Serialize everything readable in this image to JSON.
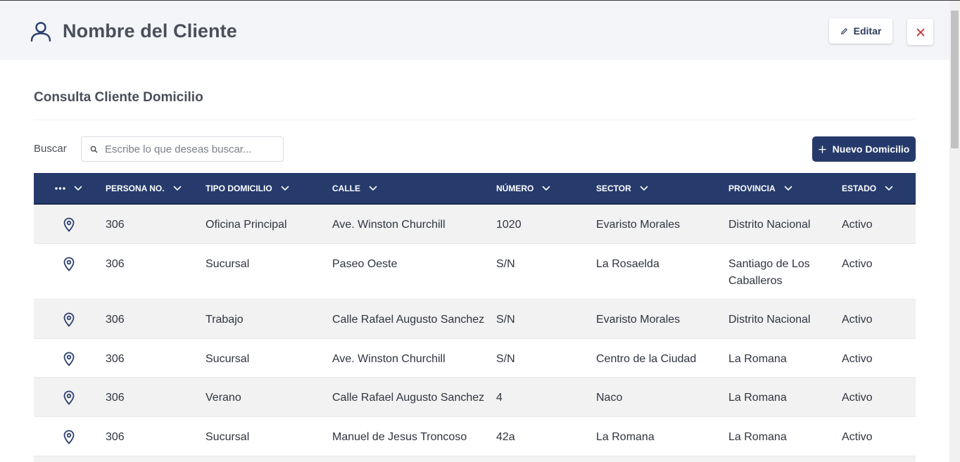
{
  "header": {
    "title": "Nombre del Cliente",
    "edit_label": "Editar"
  },
  "section": {
    "title": "Consulta Cliente Domicilio"
  },
  "search": {
    "label": "Buscar",
    "placeholder": "Escribe lo que deseas buscar...",
    "value": ""
  },
  "toolbar": {
    "new_label": "Nuevo Domicilio"
  },
  "table": {
    "columns": [
      "PERSONA NO.",
      "TIPO DOMICILIO",
      "CALLE",
      "NÚMERO",
      "SECTOR",
      "PROVINCIA",
      "ESTADO"
    ],
    "rows": [
      {
        "persona": "306",
        "tipo": "Oficina Principal",
        "calle": "Ave. Winston Churchill",
        "numero": "1020",
        "sector": "Evaristo Morales",
        "provincia": [
          "Distrito Nacional"
        ],
        "estado": "Activo"
      },
      {
        "persona": "306",
        "tipo": "Sucursal",
        "calle": "Paseo Oeste",
        "numero": "S/N",
        "sector": "La Rosaelda",
        "provincia": [
          "Santiago de Los",
          "Caballeros"
        ],
        "estado": "Activo"
      },
      {
        "persona": "306",
        "tipo": "Trabajo",
        "calle": "Calle Rafael Augusto Sanchez",
        "numero": "S/N",
        "sector": "Evaristo Morales",
        "provincia": [
          "Distrito Nacional"
        ],
        "estado": "Activo"
      },
      {
        "persona": "306",
        "tipo": "Sucursal",
        "calle": "Ave. Winston Churchill",
        "numero": "S/N",
        "sector": "Centro de la Ciudad",
        "provincia": [
          "La Romana"
        ],
        "estado": "Activo"
      },
      {
        "persona": "306",
        "tipo": "Verano",
        "calle": "Calle Rafael Augusto Sanchez",
        "numero": "4",
        "sector": "Naco",
        "provincia": [
          "La Romana"
        ],
        "estado": "Activo"
      },
      {
        "persona": "306",
        "tipo": "Sucursal",
        "calle": "Manuel de Jesus Troncoso",
        "numero": "42a",
        "sector": "La Romana",
        "provincia": [
          "La Romana"
        ],
        "estado": "Activo"
      }
    ]
  },
  "icons": {
    "user": "user-icon",
    "edit": "pencil-icon",
    "close": "close-icon",
    "search": "search-icon",
    "add": "plus-icon",
    "row_action": "map-pin-icon",
    "more": "more-dots-icon",
    "sort": "chevron-down-icon"
  },
  "colors": {
    "header_bg": "#f3f5f8",
    "primary": "#263b6c",
    "close": "#c62828",
    "row_alt": "#f2f2f2"
  }
}
